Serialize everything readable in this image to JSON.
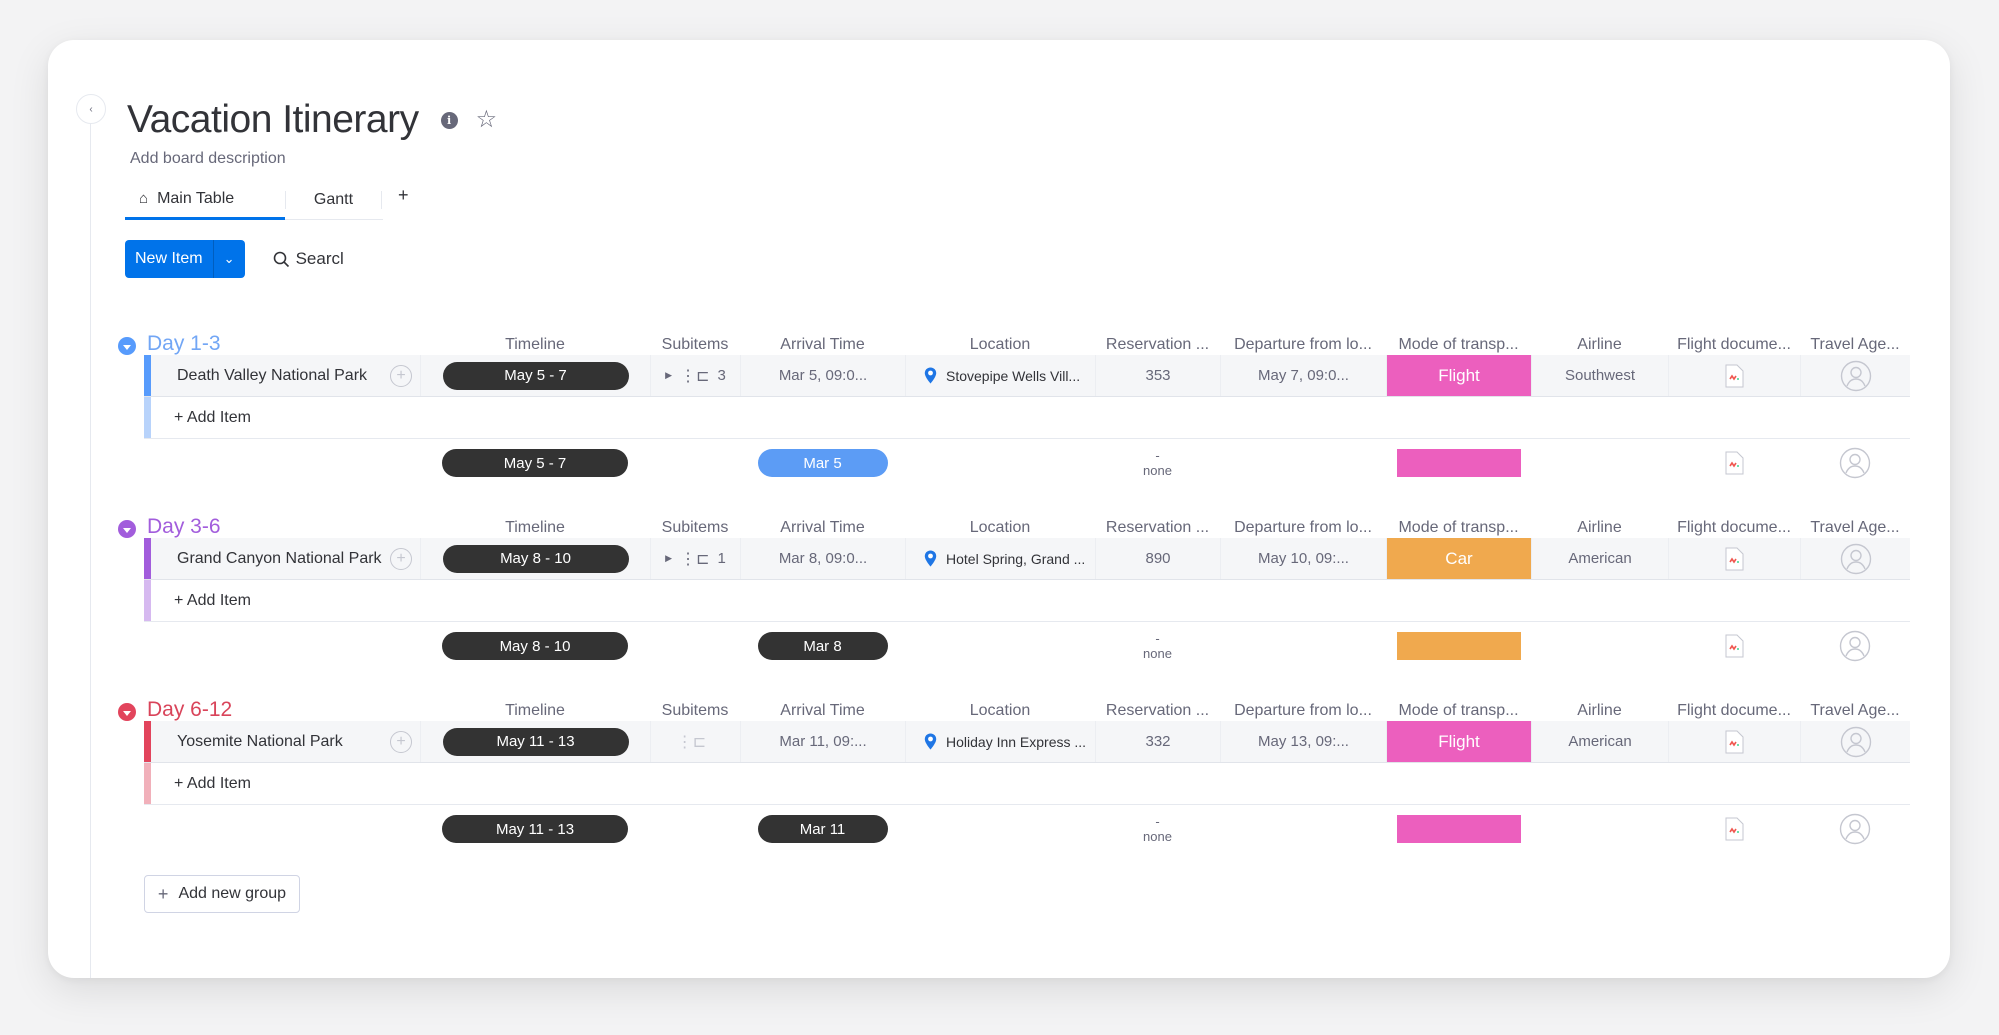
{
  "board": {
    "title": "Vacation Itinerary",
    "description_placeholder": "Add board description",
    "collapse_glyph": "‹"
  },
  "tabs": [
    {
      "label": "Main Table",
      "icon": "home-icon",
      "active": true
    },
    {
      "label": "Gantt",
      "active": false
    }
  ],
  "tab_add_label": "+",
  "toolbar": {
    "new_item_label": "New Item",
    "search_label": "Searcl"
  },
  "columns": [
    "Timeline",
    "Subitems",
    "Arrival Time",
    "Location",
    "Reservation ...",
    "Departure from lo...",
    "Mode of transp...",
    "Airline",
    "Flight docume...",
    "Travel Age..."
  ],
  "colors": {
    "flight": "#ec5fbe",
    "car": "#f0a94e",
    "pill_dark": "#333333",
    "pill_blue": "#5c9cf5",
    "primary": "#0073ea"
  },
  "groups": [
    {
      "title": "Day 1-3",
      "color": "#579bfc",
      "title_color": "#72a6f5",
      "bar_light": "#b8d3fb",
      "item": {
        "name": "Death Valley National Park",
        "timeline": "May 5 - 7",
        "subitems_count": "3",
        "arrival": "Mar 5, 09:0...",
        "location": "Stovepipe Wells Vill...",
        "reservation": "353",
        "departure": "May 7, 09:0...",
        "mode": "Flight",
        "mode_color": "#ec5fbe",
        "airline": "Southwest"
      },
      "add_item_label": "+ Add Item",
      "summary": {
        "timeline": "May 5 - 7",
        "arrival": "Mar 5",
        "arrival_pill_color": "#5c9cf5",
        "reservation_dash": "-",
        "reservation_label": "none",
        "mode_color": "#ec5fbe"
      }
    },
    {
      "title": "Day 3-6",
      "color": "#a25ddc",
      "title_color": "#a25ddc",
      "bar_light": "#d6b9f0",
      "item": {
        "name": "Grand Canyon National Park",
        "timeline": "May 8 - 10",
        "subitems_count": "1",
        "arrival": "Mar 8, 09:0...",
        "location": "Hotel Spring, Grand ...",
        "reservation": "890",
        "departure": "May 10, 09:...",
        "mode": "Car",
        "mode_color": "#f0a94e",
        "airline": "American"
      },
      "add_item_label": "+ Add Item",
      "summary": {
        "timeline": "May 8 - 10",
        "arrival": "Mar 8",
        "arrival_pill_color": "#333333",
        "reservation_dash": "-",
        "reservation_label": "none",
        "mode_color": "#f0a94e"
      }
    },
    {
      "title": "Day 6-12",
      "color": "#e2445c",
      "title_color": "#d9445a",
      "bar_light": "#f1b0ba",
      "item": {
        "name": "Yosemite National Park",
        "timeline": "May 11 - 13",
        "subitems_count": "",
        "arrival": "Mar 11, 09:...",
        "location": "Holiday Inn Express ...",
        "reservation": "332",
        "departure": "May 13, 09:...",
        "mode": "Flight",
        "mode_color": "#ec5fbe",
        "airline": "American"
      },
      "add_item_label": "+ Add Item",
      "summary": {
        "timeline": "May 11 - 13",
        "arrival": "Mar 11",
        "arrival_pill_color": "#333333",
        "reservation_dash": "-",
        "reservation_label": "none",
        "mode_color": "#ec5fbe"
      }
    }
  ],
  "add_group_label": "Add new group"
}
